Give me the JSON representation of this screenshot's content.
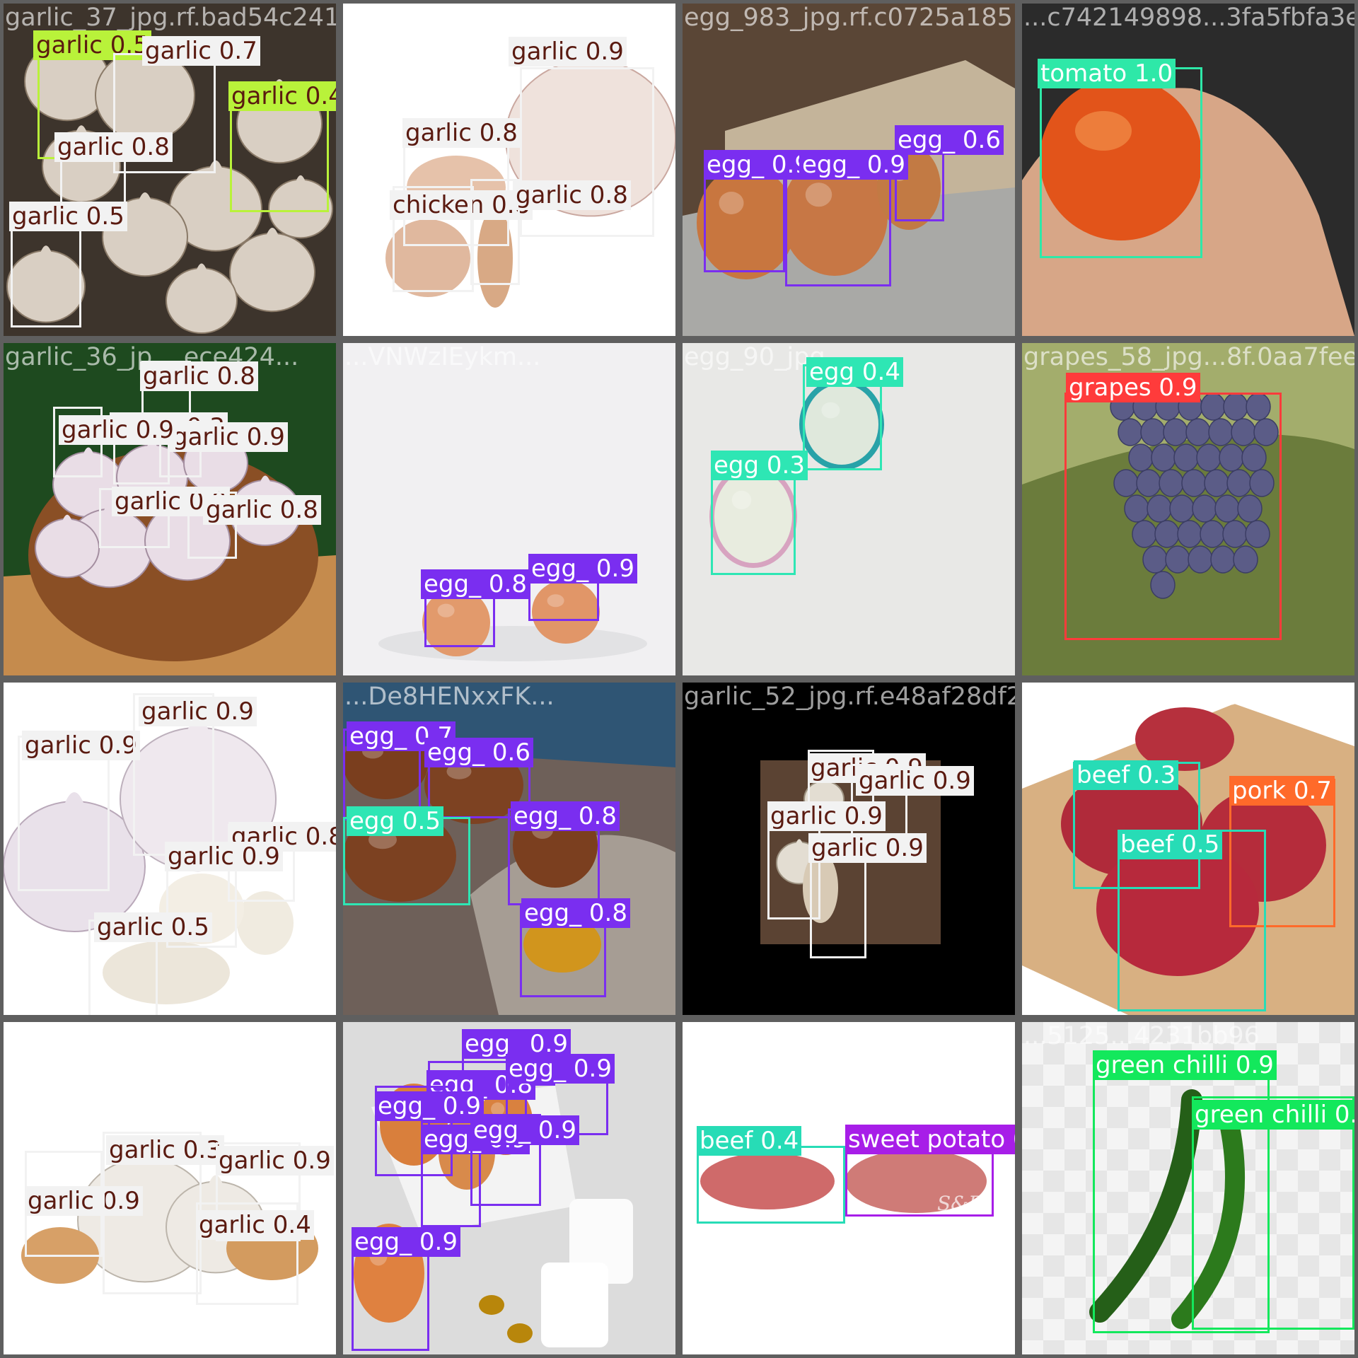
{
  "colors": {
    "garlic": "#f2f2f2",
    "garlic_box": "#ffffff",
    "garlic_yellowgreen": "#b9f23a",
    "egg_purple": "#7a2ef0",
    "egg_teal": "#2ee6b4",
    "tomato": "#2ee8a8",
    "grapes": "#ff3b3b",
    "chicken": "#f2f2f2",
    "beef": "#27dcb6",
    "pork": "#ff6a2a",
    "sweet_potato": "#a71ee8",
    "green_chilli": "#13e85c"
  },
  "tiles": [
    {
      "filename": "garlic_37_jpg.rf.bad54c2416f6741573bbe94f",
      "scene": "garlic-pile",
      "detections": [
        {
          "label": "garlic 0.5",
          "cls": "garlic"
        },
        {
          "label": "garlic 0.7",
          "cls": "garlic"
        },
        {
          "label": "garlic 0.4",
          "cls": "garlic"
        },
        {
          "label": "garlic 0.8",
          "cls": "garlic"
        },
        {
          "label": "garlic 0.5",
          "cls": "garlic"
        }
      ]
    },
    {
      "filename": "garlic_23_jpg.rf.1aceda8b5...",
      "scene": "garlic-white",
      "detections": [
        {
          "label": "garlic 0.9",
          "cls": "garlic"
        },
        {
          "label": "garlic 0.8",
          "cls": "garlic"
        },
        {
          "label": "chicken 0.8",
          "cls": "chicken"
        },
        {
          "label": "garlic 0.8",
          "cls": "garlic"
        }
      ]
    },
    {
      "filename": "egg_983_jpg.rf.c0725a185b8...",
      "scene": "egg-carton",
      "detections": [
        {
          "label": "egg_ 0.6",
          "cls": "egg"
        },
        {
          "label": "egg_ 0.9",
          "cls": "egg"
        },
        {
          "label": "egg_ 0.9",
          "cls": "egg"
        }
      ]
    },
    {
      "filename": "...c742149898...3fa5fbfa3ec7b",
      "scene": "tomato-hand",
      "detections": [
        {
          "label": "tomato 1.0",
          "cls": "tomato"
        }
      ]
    },
    {
      "filename": "garlic_36_jp... ece424...",
      "scene": "garlic-bowl",
      "detections": [
        {
          "label": "garlic 0.8",
          "cls": "garlic"
        },
        {
          "label": "garlic 0.3",
          "cls": "garlic"
        },
        {
          "label": "garlic 0.9",
          "cls": "garlic"
        },
        {
          "label": "garlic 0.9",
          "cls": "garlic"
        },
        {
          "label": "garlic 0.8",
          "cls": "garlic"
        },
        {
          "label": "garlic 0.9",
          "cls": "garlic"
        }
      ]
    },
    {
      "filename": "...VNWzIEykm...",
      "scene": "eggs-saucer",
      "detections": [
        {
          "label": "egg_ 0.8",
          "cls": "egg"
        },
        {
          "label": "egg_ 0.9",
          "cls": "egg"
        }
      ]
    },
    {
      "filename": "egg_90_jpg...",
      "scene": "eggs-green",
      "detections": [
        {
          "label": "egg 0.4",
          "cls": "egg2"
        },
        {
          "label": "egg 0.3",
          "cls": "egg2"
        }
      ]
    },
    {
      "filename": "grapes_58_jpg...8f.0aa7feed8",
      "scene": "grapes",
      "detections": [
        {
          "label": "grapes 0.9",
          "cls": "grapes"
        }
      ]
    },
    {
      "filename": "garlic_2_jpg.rf.458b70e5...",
      "scene": "garlic-bulbs",
      "detections": [
        {
          "label": "garlic 0.9",
          "cls": "garlic"
        },
        {
          "label": "garlic 0.9",
          "cls": "garlic"
        },
        {
          "label": "garlic 0.8",
          "cls": "garlic"
        },
        {
          "label": "garlic 0.9",
          "cls": "garlic"
        },
        {
          "label": "garlic 0.5",
          "cls": "garlic"
        }
      ]
    },
    {
      "filename": "...De8HENxxFK...",
      "scene": "eggs-dark",
      "detections": [
        {
          "label": "egg_ 0.7",
          "cls": "egg"
        },
        {
          "label": "egg_ 0.6",
          "cls": "egg"
        },
        {
          "label": "egg 0.5",
          "cls": "egg2"
        },
        {
          "label": "egg_ 0.8",
          "cls": "egg"
        },
        {
          "label": "egg_ 0.8",
          "cls": "egg"
        }
      ]
    },
    {
      "filename": "garlic_52_jpg.rf.e48af28df27...",
      "scene": "garlic-black",
      "detections": [
        {
          "label": "garlic 0.9",
          "cls": "garlic"
        },
        {
          "label": "garlic 0.9",
          "cls": "garlic"
        },
        {
          "label": "garlic 0.9",
          "cls": "garlic"
        },
        {
          "label": "garlic 0.9",
          "cls": "garlic"
        }
      ]
    },
    {
      "filename": "...jpg.rf.edecd26d",
      "scene": "meat-board",
      "detections": [
        {
          "label": "beef 0.3",
          "cls": "beef"
        },
        {
          "label": "pork 0.7",
          "cls": "pork"
        },
        {
          "label": "beef 0.5",
          "cls": "beef"
        }
      ]
    },
    {
      "filename": "garlic_29_jpg.rf.a87c6715ef...",
      "scene": "garlic-row",
      "detections": [
        {
          "label": "garlic 0.9",
          "cls": "garlic"
        },
        {
          "label": "garlic 0.3",
          "cls": "garlic"
        },
        {
          "label": "garlic 0.9",
          "cls": "garlic"
        },
        {
          "label": "garlic 0.4",
          "cls": "garlic"
        }
      ]
    },
    {
      "filename": "",
      "scene": "eggs-tray",
      "detections": [
        {
          "label": "egg_ 0.9",
          "cls": "egg"
        },
        {
          "label": "egg_ 0.8",
          "cls": "egg"
        },
        {
          "label": "egg_ 0.9",
          "cls": "egg"
        },
        {
          "label": "egg_ 0.9",
          "cls": "egg"
        },
        {
          "label": "egg_ 0.9",
          "cls": "egg"
        },
        {
          "label": "egg_ 0.9",
          "cls": "egg"
        },
        {
          "label": "egg_ 0.9",
          "cls": "egg"
        }
      ]
    },
    {
      "filename": "...jpg.rf.97bb85dbc...",
      "scene": "meat-white",
      "watermark": "S&R",
      "detections": [
        {
          "label": "beef 0.4",
          "cls": "beef"
        },
        {
          "label": "sweet potato 0.3",
          "cls": "sweet_potato"
        }
      ]
    },
    {
      "filename": "...5125...4231bb96",
      "scene": "chillies",
      "detections": [
        {
          "label": "green chilli 0.9",
          "cls": "green_chilli"
        },
        {
          "label": "green chilli 0.9",
          "cls": "green_chilli"
        }
      ]
    }
  ]
}
